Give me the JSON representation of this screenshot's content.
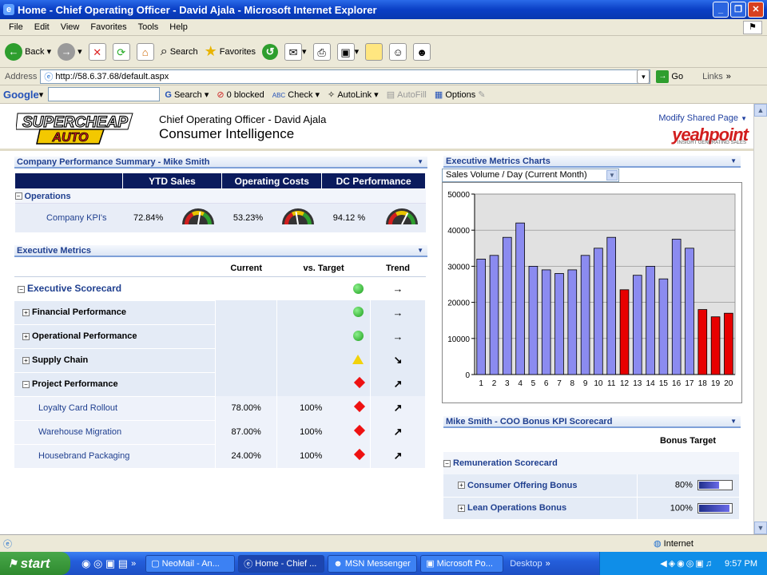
{
  "window": {
    "title": "Home - Chief Operating Officer - David Ajala - Microsoft Internet Explorer"
  },
  "menu": [
    "File",
    "Edit",
    "View",
    "Favorites",
    "Tools",
    "Help"
  ],
  "toolbar": {
    "back": "Back",
    "search": "Search",
    "favorites": "Favorites"
  },
  "address": {
    "label": "Address",
    "url": "http://58.6.37.68/default.aspx",
    "go": "Go",
    "links": "Links"
  },
  "google": {
    "label": "Google",
    "search": "Search",
    "blocked": "0 blocked",
    "check": "Check",
    "autolink": "AutoLink",
    "autofill": "AutoFill",
    "options": "Options"
  },
  "header": {
    "logo_top": "SUPERCHEAP",
    "logo_bottom": "AUTO",
    "subtitle": "Chief Operating Officer - David Ajala",
    "title": "Consumer Intelligence",
    "modify": "Modify Shared Page",
    "brand": "yeahpoint",
    "brand_tag": "INSIGHT GENERATING SALES"
  },
  "kpi_panel": {
    "title": "Company Performance Summary - Mike Smith",
    "columns": [
      "YTD Sales",
      "Operating Costs",
      "DC Performance"
    ],
    "group": "Operations",
    "row_label": "Company KPI's",
    "values": [
      "72.84%",
      "53.23%",
      "94.12 %"
    ],
    "gauge_levels": [
      0.55,
      0.45,
      0.65
    ]
  },
  "exec_panel": {
    "title": "Executive Metrics",
    "columns": [
      "Current",
      "vs. Target",
      "Trend"
    ],
    "rows": [
      {
        "label": "Executive Scorecard",
        "current": "",
        "target": "",
        "status": "green",
        "trend": "→"
      },
      {
        "label": "Financial Performance",
        "current": "",
        "target": "",
        "status": "green",
        "trend": "→"
      },
      {
        "label": "Operational Performance",
        "current": "",
        "target": "",
        "status": "green",
        "trend": "→"
      },
      {
        "label": "Supply Chain",
        "current": "",
        "target": "",
        "status": "yellow",
        "trend": "↘"
      },
      {
        "label": "Project Performance",
        "current": "",
        "target": "",
        "status": "red",
        "trend": "↗"
      },
      {
        "label": "Loyalty Card Rollout",
        "current": "78.00%",
        "target": "100%",
        "status": "red",
        "trend": "↗"
      },
      {
        "label": "Warehouse Migration",
        "current": "87.00%",
        "target": "100%",
        "status": "red",
        "trend": "↗"
      },
      {
        "label": "Housebrand Packaging",
        "current": "24.00%",
        "target": "100%",
        "status": "red",
        "trend": "↗"
      }
    ]
  },
  "charts_panel": {
    "title": "Executive Metrics Charts",
    "selector": "Sales Volume / Day (Current Month)"
  },
  "chart_data": {
    "type": "bar",
    "categories": [
      "1",
      "2",
      "3",
      "4",
      "5",
      "6",
      "7",
      "8",
      "9",
      "10",
      "11",
      "12",
      "13",
      "14",
      "15",
      "16",
      "17",
      "18",
      "19",
      "20"
    ],
    "values": [
      32000,
      33000,
      38000,
      42000,
      30000,
      29000,
      28000,
      29000,
      33000,
      35000,
      38000,
      23500,
      27500,
      30000,
      26500,
      37500,
      35000,
      18000,
      16000,
      17000
    ],
    "colors": [
      "#8b8bf0",
      "#8b8bf0",
      "#8b8bf0",
      "#8b8bf0",
      "#8b8bf0",
      "#8b8bf0",
      "#8b8bf0",
      "#8b8bf0",
      "#8b8bf0",
      "#8b8bf0",
      "#8b8bf0",
      "#e80000",
      "#8b8bf0",
      "#8b8bf0",
      "#8b8bf0",
      "#8b8bf0",
      "#8b8bf0",
      "#e80000",
      "#e80000",
      "#e80000"
    ],
    "yticks": [
      "0",
      "10000",
      "20000",
      "30000",
      "40000",
      "50000"
    ],
    "ylim": [
      0,
      50000
    ],
    "grid": true
  },
  "bonus_panel": {
    "title": "Mike Smith - COO Bonus KPI Scorecard",
    "column": "Bonus Target",
    "group": "Remuneration Scorecard",
    "rows": [
      {
        "label": "Consumer Offering Bonus",
        "value": "80%",
        "level": 0.6
      },
      {
        "label": "Lean Operations Bonus",
        "value": "100%",
        "level": 0.9
      }
    ]
  },
  "status": {
    "zone": "Internet"
  },
  "taskbar": {
    "start": "start",
    "tasks": [
      "NeoMail - An...",
      "Home - Chief ...",
      "MSN Messenger",
      "Microsoft Po..."
    ],
    "desktop": "Desktop",
    "time": "9:57 PM"
  }
}
